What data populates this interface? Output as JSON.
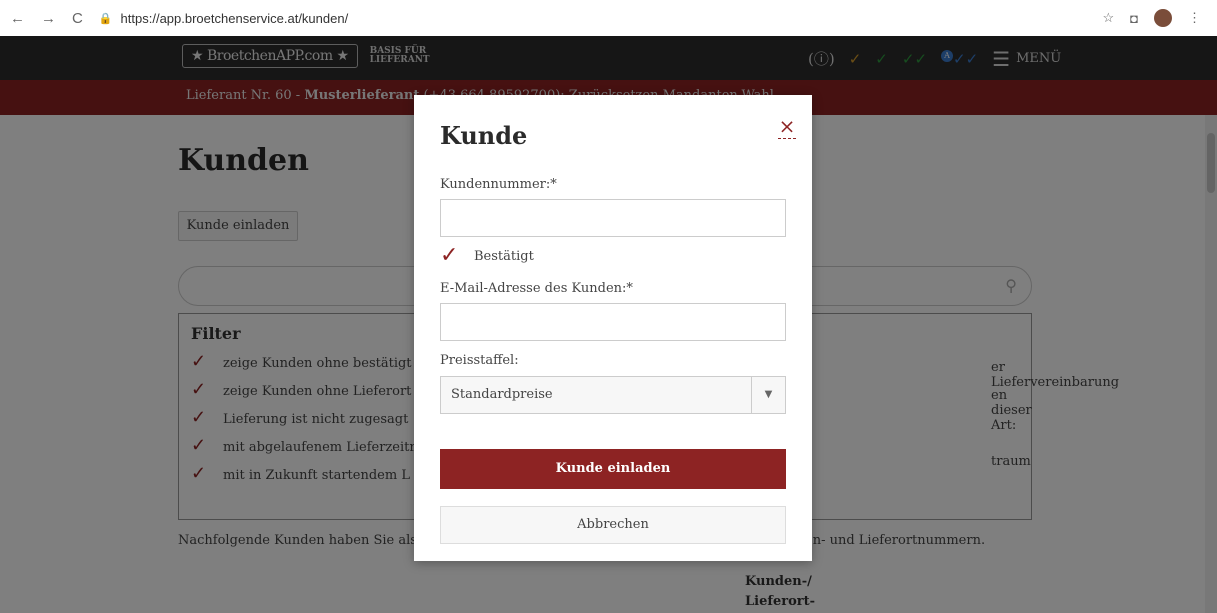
{
  "browser": {
    "url": "https://app.broetchenservice.at/kunden/"
  },
  "header": {
    "logo": "★ BroetchenAPP.com ★",
    "tagline_line1": "BASIS FÜR",
    "tagline_line2": "LIEFERANT",
    "menu_label": "MENÜ",
    "badge_count": "A"
  },
  "notice": {
    "prefix": "Lieferant Nr. 60 - ",
    "name": "Musterlieferant",
    "suffix": " (+43 664 89592700): Zurücksetzen Mandanten-Wahl"
  },
  "page": {
    "title": "Kunden",
    "invite_button": "Kunde einladen",
    "filter_title": "Filter",
    "filters": [
      "zeige Kunden ohne bestätigt",
      "zeige Kunden ohne Lieferort",
      "Lieferung ist nicht zugesagt",
      "mit abgelaufenem Lieferzeitr",
      "mit in Zukunft startendem L"
    ],
    "filters_right": [
      "er Liefervereinbarung",
      "en dieser Art:",
      "traum"
    ],
    "note_left": "Nachfolgende Kunden haben Sie als L",
    "note_right": "en- und Lieferortnummern.",
    "col_header_1": "Kunden-/",
    "col_header_2": "Lieferort-"
  },
  "modal": {
    "title": "Kunde",
    "customer_number_label": "Kundennummer:*",
    "customer_number_value": "",
    "confirmed_label": "Bestätigt",
    "email_label": "E-Mail-Adresse des Kunden:*",
    "email_value": "",
    "price_label": "Preisstaffel:",
    "price_selected": "Standardpreise",
    "submit_label": "Kunde einladen",
    "cancel_label": "Abbrechen"
  }
}
